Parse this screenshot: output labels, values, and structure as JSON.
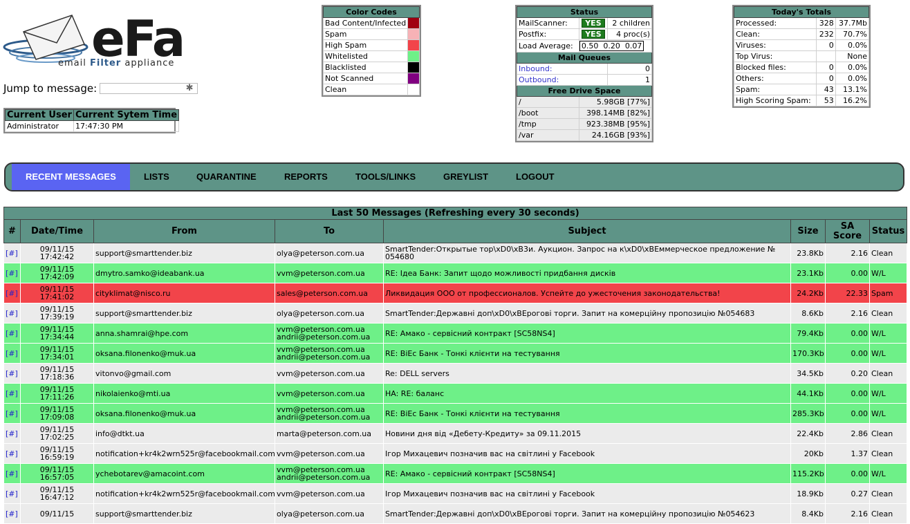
{
  "logo": {
    "brand": "eFa",
    "tagline_pre": "email ",
    "tagline_bold": "Filter",
    "tagline_post": " appliance"
  },
  "jump": {
    "label": "Jump to message:",
    "value": "",
    "icon": "search-icon"
  },
  "current": {
    "user_header": "Current User",
    "time_header": "Current Sytem Time",
    "user": "Administrator",
    "time": "17:47:30 PM"
  },
  "color_codes": {
    "title": "Color Codes",
    "items": [
      {
        "label": "Bad Content/Infected",
        "color": "#a00010"
      },
      {
        "label": "Spam",
        "color": "#f7b2b6"
      },
      {
        "label": "High Spam",
        "color": "#f2444a"
      },
      {
        "label": "Whitelisted",
        "color": "#6ef088"
      },
      {
        "label": "Blacklisted",
        "color": "#000000"
      },
      {
        "label": "Not Scanned",
        "color": "#800080"
      },
      {
        "label": "Clean",
        "color": "#ffffff"
      }
    ]
  },
  "status": {
    "title": "Status",
    "mailscanner_label": "MailScanner:",
    "mailscanner_status": "YES",
    "mailscanner_detail": "2 children",
    "postfix_label": "Postfix:",
    "postfix_status": "YES",
    "postfix_detail": "4 proc(s)",
    "load_label": "Load Average:",
    "load1": "0.50",
    "load5": "0.20",
    "load15": "0.07",
    "queues_title": "Mail Queues",
    "inbound_label": "Inbound:",
    "inbound_value": "0",
    "outbound_label": "Outbound:",
    "outbound_value": "1",
    "drive_title": "Free Drive Space",
    "drives": [
      {
        "mount": "/",
        "free": "5.98GB [77%]"
      },
      {
        "mount": "/boot",
        "free": "398.14MB [82%]"
      },
      {
        "mount": "/tmp",
        "free": "923.38MB [95%]"
      },
      {
        "mount": "/var",
        "free": "24.16GB [93%]"
      }
    ]
  },
  "totals": {
    "title": "Today's Totals",
    "rows": [
      {
        "label": "Processed:",
        "count": "328",
        "extra": "37.7Mb"
      },
      {
        "label": "Clean:",
        "count": "232",
        "extra": "70.7%"
      },
      {
        "label": "Viruses:",
        "count": "0",
        "extra": "0.0%"
      },
      {
        "label": "Top Virus:",
        "count": "",
        "extra": "None"
      },
      {
        "label": "Blocked files:",
        "count": "0",
        "extra": "0.0%"
      },
      {
        "label": "Others:",
        "count": "0",
        "extra": "0.0%"
      },
      {
        "label": "Spam:",
        "count": "43",
        "extra": "13.1%"
      },
      {
        "label": "High Scoring Spam:",
        "count": "53",
        "extra": "16.2%"
      }
    ]
  },
  "nav": {
    "items": [
      "RECENT MESSAGES",
      "LISTS",
      "QUARANTINE",
      "REPORTS",
      "TOOLS/LINKS",
      "GREYLIST",
      "LOGOUT"
    ]
  },
  "messages": {
    "title": "Last 50 Messages (Refreshing every 30 seconds)",
    "columns": {
      "hash": "#",
      "datetime": "Date/Time",
      "from": "From",
      "to": "To",
      "subject": "Subject",
      "size": "Size",
      "score_line1": "SA",
      "score_line2": "Score",
      "status": "Status"
    },
    "rows": [
      {
        "kind": "clean",
        "hash": "[#]",
        "date": "09/11/15",
        "time": "17:42:42",
        "from": "support@smarttender.biz",
        "to1": "olya@peterson.com.ua",
        "to2": "",
        "subject": "SmartTender:Открытые тор\\xD0\\xB3и. Аукцион. Запрос на к\\xD0\\xBEммерческое предложение № 054680",
        "size": "23.8Kb",
        "score": "2.16",
        "status": "Clean"
      },
      {
        "kind": "wl",
        "hash": "[#]",
        "date": "09/11/15",
        "time": "17:42:09",
        "from": "dmytro.samko@ideabank.ua",
        "to1": "vvm@peterson.com.ua",
        "to2": "",
        "subject": "RE: Iдеа Банк: Запит щодо можливості придбання дисків",
        "size": "23.1Kb",
        "score": "0.00",
        "status": "W/L"
      },
      {
        "kind": "spam",
        "hash": "[#]",
        "date": "09/11/15",
        "time": "17:41:02",
        "from": "cityklimat@nisco.ru",
        "to1": "sales@peterson.com.ua",
        "to2": "",
        "subject": "Ликвидация ООО от профессионалов. Успейте до ужесточения законодательства!",
        "size": "24.2Kb",
        "score": "22.33",
        "status": "Spam"
      },
      {
        "kind": "clean",
        "hash": "[#]",
        "date": "09/11/15",
        "time": "17:39:19",
        "from": "support@smarttender.biz",
        "to1": "olya@peterson.com.ua",
        "to2": "",
        "subject": "SmartTender:Державні доп\\xD0\\xBEрогові торги. Запит на комерційну пропозицію №054683",
        "size": "8.6Kb",
        "score": "2.16",
        "status": "Clean"
      },
      {
        "kind": "wl",
        "hash": "[#]",
        "date": "09/11/15",
        "time": "17:34:44",
        "from": "anna.shamrai@hpe.com",
        "to1": "vvm@peterson.com.ua",
        "to2": "andrii@peterson.com.ua",
        "subject": "RE: Амако - сервісний контракт [SC58NS4]",
        "size": "79.4Kb",
        "score": "0.00",
        "status": "W/L"
      },
      {
        "kind": "wl",
        "hash": "[#]",
        "date": "09/11/15",
        "time": "17:34:01",
        "from": "oksana.filonenko@muk.ua",
        "to1": "vvm@peterson.com.ua",
        "to2": "andrii@peterson.com.ua",
        "subject": "RE: BiEc Банк - Тонкі клієнти на тестування",
        "size": "170.3Kb",
        "score": "0.00",
        "status": "W/L"
      },
      {
        "kind": "clean",
        "hash": "[#]",
        "date": "09/11/15",
        "time": "17:18:36",
        "from": "vitonvo@gmail.com",
        "to1": "vvm@peterson.com.ua",
        "to2": "",
        "subject": "Re: DELL servers",
        "size": "34.5Kb",
        "score": "0.20",
        "status": "Clean"
      },
      {
        "kind": "wl",
        "hash": "[#]",
        "date": "09/11/15",
        "time": "17:11:26",
        "from": "nikolaienko@mti.ua",
        "to1": "vvm@peterson.com.ua",
        "to2": "",
        "subject": "HA: RE: баланс",
        "size": "44.1Kb",
        "score": "0.00",
        "status": "W/L"
      },
      {
        "kind": "wl",
        "hash": "[#]",
        "date": "09/11/15",
        "time": "17:09:08",
        "from": "oksana.filonenko@muk.ua",
        "to1": "vvm@peterson.com.ua",
        "to2": "andrii@peterson.com.ua",
        "subject": "RE: BiEc Банк - Тонкі клієнти на тестування",
        "size": "285.3Kb",
        "score": "0.00",
        "status": "W/L"
      },
      {
        "kind": "clean",
        "hash": "[#]",
        "date": "09/11/15",
        "time": "17:02:25",
        "from": "info@dtkt.ua",
        "to1": "marta@peterson.com.ua",
        "to2": "",
        "subject": "Новини дня від «Дебету-Кредиту» за 09.11.2015",
        "size": "22.4Kb",
        "score": "2.86",
        "status": "Clean"
      },
      {
        "kind": "clean",
        "hash": "[#]",
        "date": "09/11/15",
        "time": "16:59:19",
        "from": "notification+kr4k2wrn525r@facebookmail.com",
        "to1": "vvm@peterson.com.ua",
        "to2": "",
        "subject": "Iгор Михацевич позначив вас на світлині у Facebook",
        "size": "20Kb",
        "score": "1.37",
        "status": "Clean"
      },
      {
        "kind": "wl",
        "hash": "[#]",
        "date": "09/11/15",
        "time": "16:57:05",
        "from": "ychebotarev@amacoint.com",
        "to1": "vvm@peterson.com.ua",
        "to2": "andrii@peterson.com.ua",
        "subject": "RE: Амако - сервісний контракт [SC58NS4]",
        "size": "115.2Kb",
        "score": "0.00",
        "status": "W/L"
      },
      {
        "kind": "clean",
        "hash": "[#]",
        "date": "09/11/15",
        "time": "16:47:12",
        "from": "notification+kr4k2wrn525r@facebookmail.com",
        "to1": "vvm@peterson.com.ua",
        "to2": "",
        "subject": "Iгор Михацевич позначив вас на світлині у Facebook",
        "size": "18.9Kb",
        "score": "0.27",
        "status": "Clean"
      },
      {
        "kind": "clean",
        "hash": "[#]",
        "date": "09/11/15",
        "time": "",
        "from": "support@smarttender.biz",
        "to1": "olya@peterson.com.ua",
        "to2": "",
        "subject": "SmartTender:Державні доп\\xD0\\xBEрогові торги. Запит на комерційну пропозицію №054623",
        "size": "8.4Kb",
        "score": "2.16",
        "status": "Clean"
      }
    ]
  }
}
